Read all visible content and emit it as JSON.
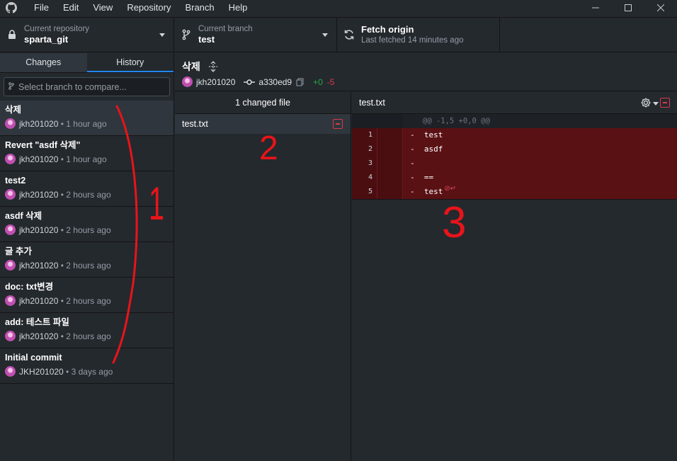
{
  "menu": [
    "File",
    "Edit",
    "View",
    "Repository",
    "Branch",
    "Help"
  ],
  "toolbar": {
    "repo_label": "Current repository",
    "repo_value": "sparta_git",
    "branch_label": "Current branch",
    "branch_value": "test",
    "fetch_title": "Fetch origin",
    "fetch_subtitle": "Last fetched 14 minutes ago"
  },
  "sidebar": {
    "tabs": [
      "Changes",
      "History"
    ],
    "selected_tab": "History",
    "branch_filter_placeholder": "Select branch to compare...",
    "commits": [
      {
        "title": "삭제",
        "author": "jkh201020",
        "time": "1 hour ago"
      },
      {
        "title": "Revert \"asdf 삭제\"",
        "author": "jkh201020",
        "time": "1 hour ago"
      },
      {
        "title": "test2",
        "author": "jkh201020",
        "time": "2 hours ago"
      },
      {
        "title": "asdf 삭제",
        "author": "jkh201020",
        "time": "2 hours ago"
      },
      {
        "title": "글 추가",
        "author": "jkh201020",
        "time": "2 hours ago"
      },
      {
        "title": "doc: txt변경",
        "author": "jkh201020",
        "time": "2 hours ago"
      },
      {
        "title": "add: 테스트 파일",
        "author": "jkh201020",
        "time": "2 hours ago"
      },
      {
        "title": "Initial commit",
        "author": "JKH201020",
        "time": "3 days ago"
      }
    ]
  },
  "commit": {
    "title": "삭제",
    "author": "jkh201020",
    "sha": "a330ed9",
    "added": "+0",
    "removed": "-5"
  },
  "files": {
    "header": "1 changed file",
    "items": [
      "test.txt"
    ]
  },
  "diff": {
    "filename": "test.txt",
    "hunk": "@@ -1,5 +0,0 @@",
    "lines": [
      {
        "num": "1",
        "text": "-  test"
      },
      {
        "num": "2",
        "text": "-  asdf"
      },
      {
        "num": "3",
        "text": "-"
      },
      {
        "num": "4",
        "text": "-  =="
      },
      {
        "num": "5",
        "text": "-  test"
      }
    ]
  },
  "annotations": [
    "1",
    "2",
    "3"
  ],
  "colors": {
    "accent": "#2188ff",
    "removed": "#d73a49",
    "added": "#28a745",
    "annotation": "#e8141a"
  }
}
